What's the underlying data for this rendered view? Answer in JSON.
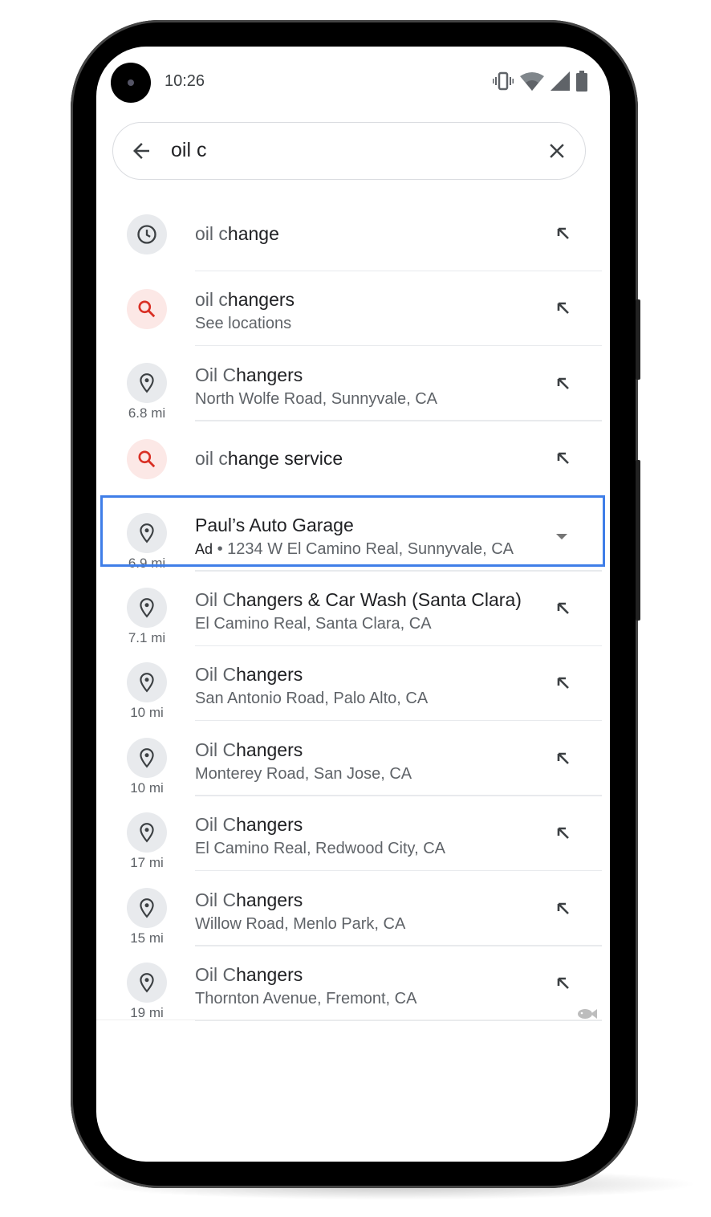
{
  "status_bar": {
    "time": "10:26",
    "icons": [
      "vibrate-icon",
      "wifi-icon",
      "signal-icon",
      "battery-icon"
    ]
  },
  "search": {
    "query": "oil c"
  },
  "suggestions": [
    {
      "icon": "history",
      "match": "oil c",
      "rest": "hange",
      "sub": "",
      "distance": "",
      "action": "fill"
    },
    {
      "icon": "search",
      "match": "oil c",
      "rest": "hangers",
      "sub": "See locations",
      "distance": "",
      "action": "fill"
    },
    {
      "icon": "place",
      "match": "Oil C",
      "rest": "hangers",
      "sub": "North Wolfe Road, Sunnyvale, CA",
      "distance": "6.8 mi",
      "action": "fill"
    },
    {
      "icon": "search",
      "match": "oil c",
      "rest": "hange service",
      "sub": "",
      "distance": "",
      "action": "fill"
    },
    {
      "icon": "place",
      "match": "",
      "rest": "Paul’s Auto Garage",
      "ad": "Ad",
      "sub": " • 1234 W El Camino Real, Sunnyvale, CA",
      "distance": "6.9 mi",
      "action": "expand",
      "highlighted": true
    },
    {
      "icon": "place",
      "match": "Oil C",
      "rest": "hangers & Car Wash (Santa Clara)",
      "sub": "El Camino Real, Santa Clara, CA",
      "distance": "7.1 mi",
      "action": "fill"
    },
    {
      "icon": "place",
      "match": "Oil C",
      "rest": "hangers",
      "sub": "San Antonio Road, Palo Alto, CA",
      "distance": "10 mi",
      "action": "fill"
    },
    {
      "icon": "place",
      "match": "Oil C",
      "rest": "hangers",
      "sub": "Monterey Road, San Jose, CA",
      "distance": "10 mi",
      "action": "fill"
    },
    {
      "icon": "place",
      "match": "Oil C",
      "rest": "hangers",
      "sub": "El Camino Real, Redwood City, CA",
      "distance": "17 mi",
      "action": "fill"
    },
    {
      "icon": "place",
      "match": "Oil C",
      "rest": "hangers",
      "sub": "Willow Road, Menlo Park, CA",
      "distance": "15 mi",
      "action": "fill"
    },
    {
      "icon": "place",
      "match": "Oil C",
      "rest": "hangers",
      "sub": "Thornton Avenue, Fremont, CA",
      "distance": "19 mi",
      "action": "fill"
    }
  ],
  "colors": {
    "highlight": "#3f7ee8",
    "search_icon": "#d93025",
    "text_primary": "#202124",
    "text_secondary": "#5f6368"
  }
}
